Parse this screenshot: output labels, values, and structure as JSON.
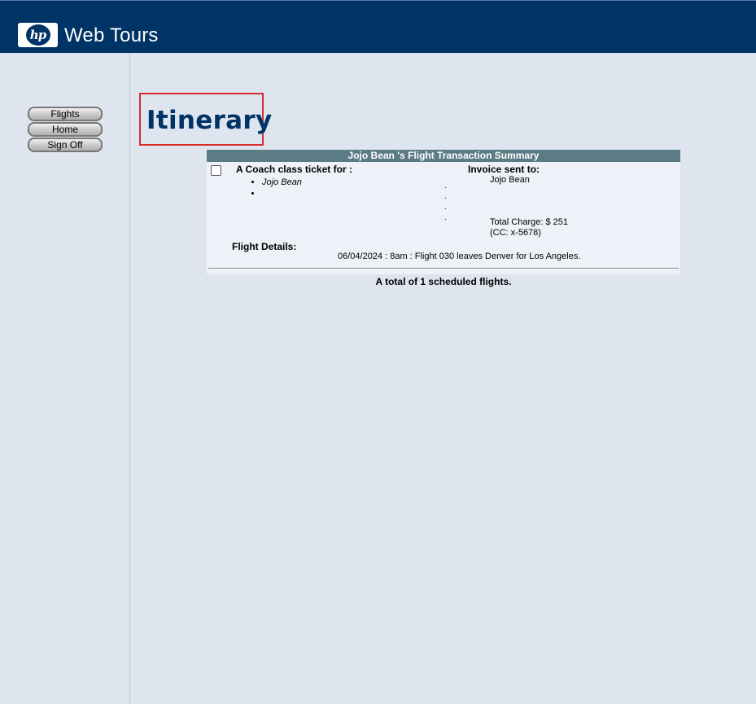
{
  "header": {
    "logo_text": "hp",
    "brand": "Web Tours",
    "colors": {
      "bar": "#003366",
      "page_bg": "#dfe5ef"
    }
  },
  "nav": {
    "items": [
      {
        "label": "Flights"
      },
      {
        "label": "Home"
      },
      {
        "label": "Sign Off"
      }
    ]
  },
  "page": {
    "title": "Itinerary",
    "highlight_color": "#d62c2c"
  },
  "summary": {
    "header": "Jojo Bean 's Flight Transaction Summary",
    "selected": false,
    "ticket_label": "A Coach class ticket for :",
    "passengers": [
      "Jojo Bean",
      ""
    ],
    "invoice_label": "Invoice sent to:",
    "invoice_name": "Jojo Bean",
    "address_lines": [
      ".",
      ".",
      ".",
      "."
    ],
    "total_charge": "Total Charge: $ 251",
    "card": "(CC: x-5678)",
    "flight_details_label": "Flight Details:",
    "flight": "06/04/2024 : 8am : Flight 030 leaves Denver for Los Angeles."
  },
  "footer": {
    "total": "A total of 1 scheduled flights."
  }
}
